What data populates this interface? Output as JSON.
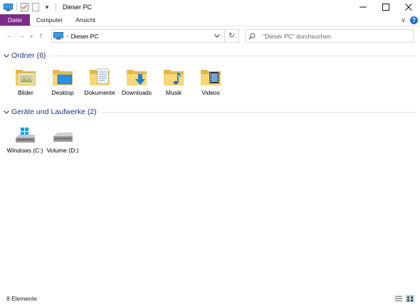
{
  "window": {
    "title": "Dieser PC",
    "quick_access_dropdown": "▾",
    "controls": {
      "minimize": "—",
      "maximize": "☐",
      "close": "✕"
    }
  },
  "ribbon": {
    "tabs": [
      {
        "label": "Datei",
        "active": true
      },
      {
        "label": "Computer"
      },
      {
        "label": "Ansicht"
      }
    ],
    "collapse": "∨",
    "help": "?"
  },
  "nav": {
    "back": "←",
    "forward": "→",
    "recent": "∨",
    "up": "↑",
    "breadcrumb": [
      "Dieser PC"
    ],
    "refresh": "↻"
  },
  "search": {
    "placeholder": "\"Dieser PC\" durchsuchen"
  },
  "groups": {
    "folders": {
      "title": "Ordner (6)",
      "items": [
        {
          "label": "Bilder",
          "icon": "pictures-folder-icon"
        },
        {
          "label": "Desktop",
          "icon": "desktop-folder-icon"
        },
        {
          "label": "Dokumente",
          "icon": "documents-folder-icon"
        },
        {
          "label": "Downloads",
          "icon": "downloads-folder-icon"
        },
        {
          "label": "Musik",
          "icon": "music-folder-icon"
        },
        {
          "label": "Videos",
          "icon": "videos-folder-icon"
        }
      ]
    },
    "drives": {
      "title": "Geräte und Laufwerke (2)",
      "items": [
        {
          "label": "Windows (C:)",
          "icon": "windows-drive-icon"
        },
        {
          "label": "Volume (D:)",
          "icon": "hard-drive-icon"
        }
      ]
    }
  },
  "status": {
    "count": "8 Elemente"
  },
  "colors": {
    "file_tab": "#7c2b8a",
    "group_title": "#1e3287",
    "folder_yellow": "#f8d775",
    "accent_blue": "#1d6fd1"
  }
}
